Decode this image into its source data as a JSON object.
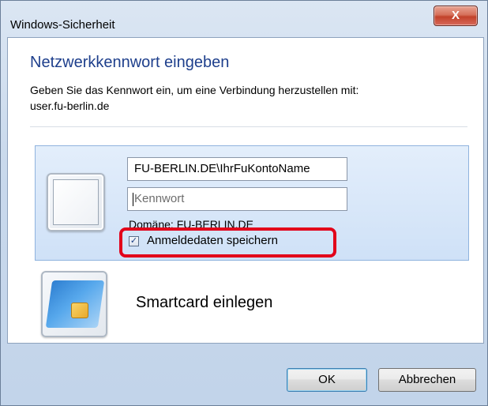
{
  "window": {
    "title": "Windows-Sicherheit",
    "close_label": "X"
  },
  "dialog": {
    "heading": "Netzwerkkennwort eingeben",
    "description_line1": "Geben Sie das Kennwort ein, um eine Verbindung herzustellen mit:",
    "description_line2": "user.fu-berlin.de"
  },
  "credential": {
    "username_value": "FU-BERLIN.DE\\IhrFuKontoName",
    "password_placeholder": "Kennwort",
    "domain_text": "Domäne: FU-BERLIN.DE",
    "remember_label": "Anmeldedaten speichern",
    "remember_checked": true,
    "checkmark": "✓"
  },
  "smartcard": {
    "label": "Smartcard einlegen"
  },
  "buttons": {
    "ok_label": "OK",
    "cancel_label": "Abbrechen"
  },
  "colors": {
    "heading": "#1e3f8c",
    "highlight_border": "#e2001a",
    "tile_border": "#8fb3de",
    "close_button": "#c2422a"
  },
  "icons": {
    "close": "close-icon",
    "user_tile": "user-tile-icon",
    "smartcard": "smartcard-icon",
    "checkbox": "checkbox-checked-icon"
  }
}
